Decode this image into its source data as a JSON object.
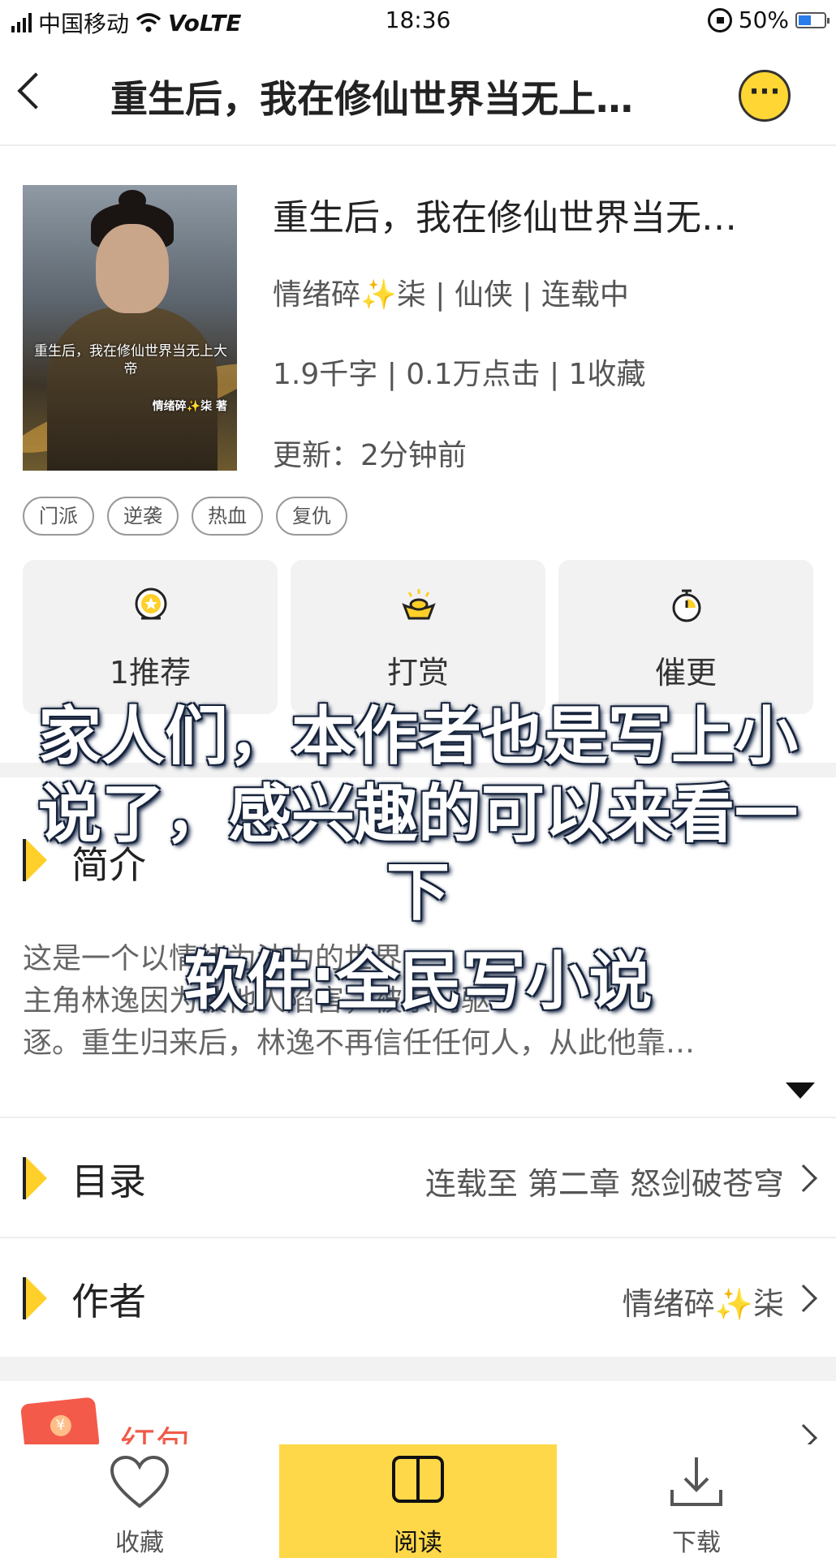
{
  "status_bar": {
    "carrier": "中国移动",
    "network": "VoLTE",
    "time": "18:36",
    "battery": "50%",
    "battery_level": 0.5
  },
  "nav": {
    "title": "重生后，我在修仙世界当无上…",
    "more_icon": "more-dots-icon"
  },
  "book": {
    "cover_title": "重生后，我在修仙世界当无上大帝",
    "cover_author": "情绪碎✨柒 著",
    "title": "重生后，我在修仙世界当无…",
    "meta_line1": "情绪碎✨柒 | 仙侠 | 连载中",
    "meta_line2": "1.9千字 | 0.1万点击 | 1收藏",
    "meta_line3": "更新：2分钟前"
  },
  "tags": [
    "门派",
    "逆袭",
    "热血",
    "复仇"
  ],
  "actions": [
    {
      "label": "1推荐",
      "icon": "recommend-icon"
    },
    {
      "label": "打赏",
      "icon": "gold-ingot-icon"
    },
    {
      "label": "催更",
      "icon": "timer-icon"
    }
  ],
  "intro": {
    "title": "简介",
    "lines": [
      "这是一个以情绪为法力的世界",
      "主角林逸因为被他人陷害，被宗门驱",
      "逐。重生归来后，林逸不再信任任何人，从此他靠…"
    ]
  },
  "catalog": {
    "title": "目录",
    "value": "连载至 第二章  怒剑破苍穹"
  },
  "author": {
    "title": "作者",
    "value": "情绪碎✨柒"
  },
  "red_packet": {
    "label": "红包"
  },
  "bottom_bar": {
    "collect": "收藏",
    "read": "阅读",
    "download": "下载"
  },
  "overlay": {
    "line1": "家人们，本作者也是写上小说了，感兴趣的可以来看一下",
    "line2": "软件:全民写小说"
  },
  "colors": {
    "accent": "#ffd84a",
    "red": "#f05a4a"
  }
}
